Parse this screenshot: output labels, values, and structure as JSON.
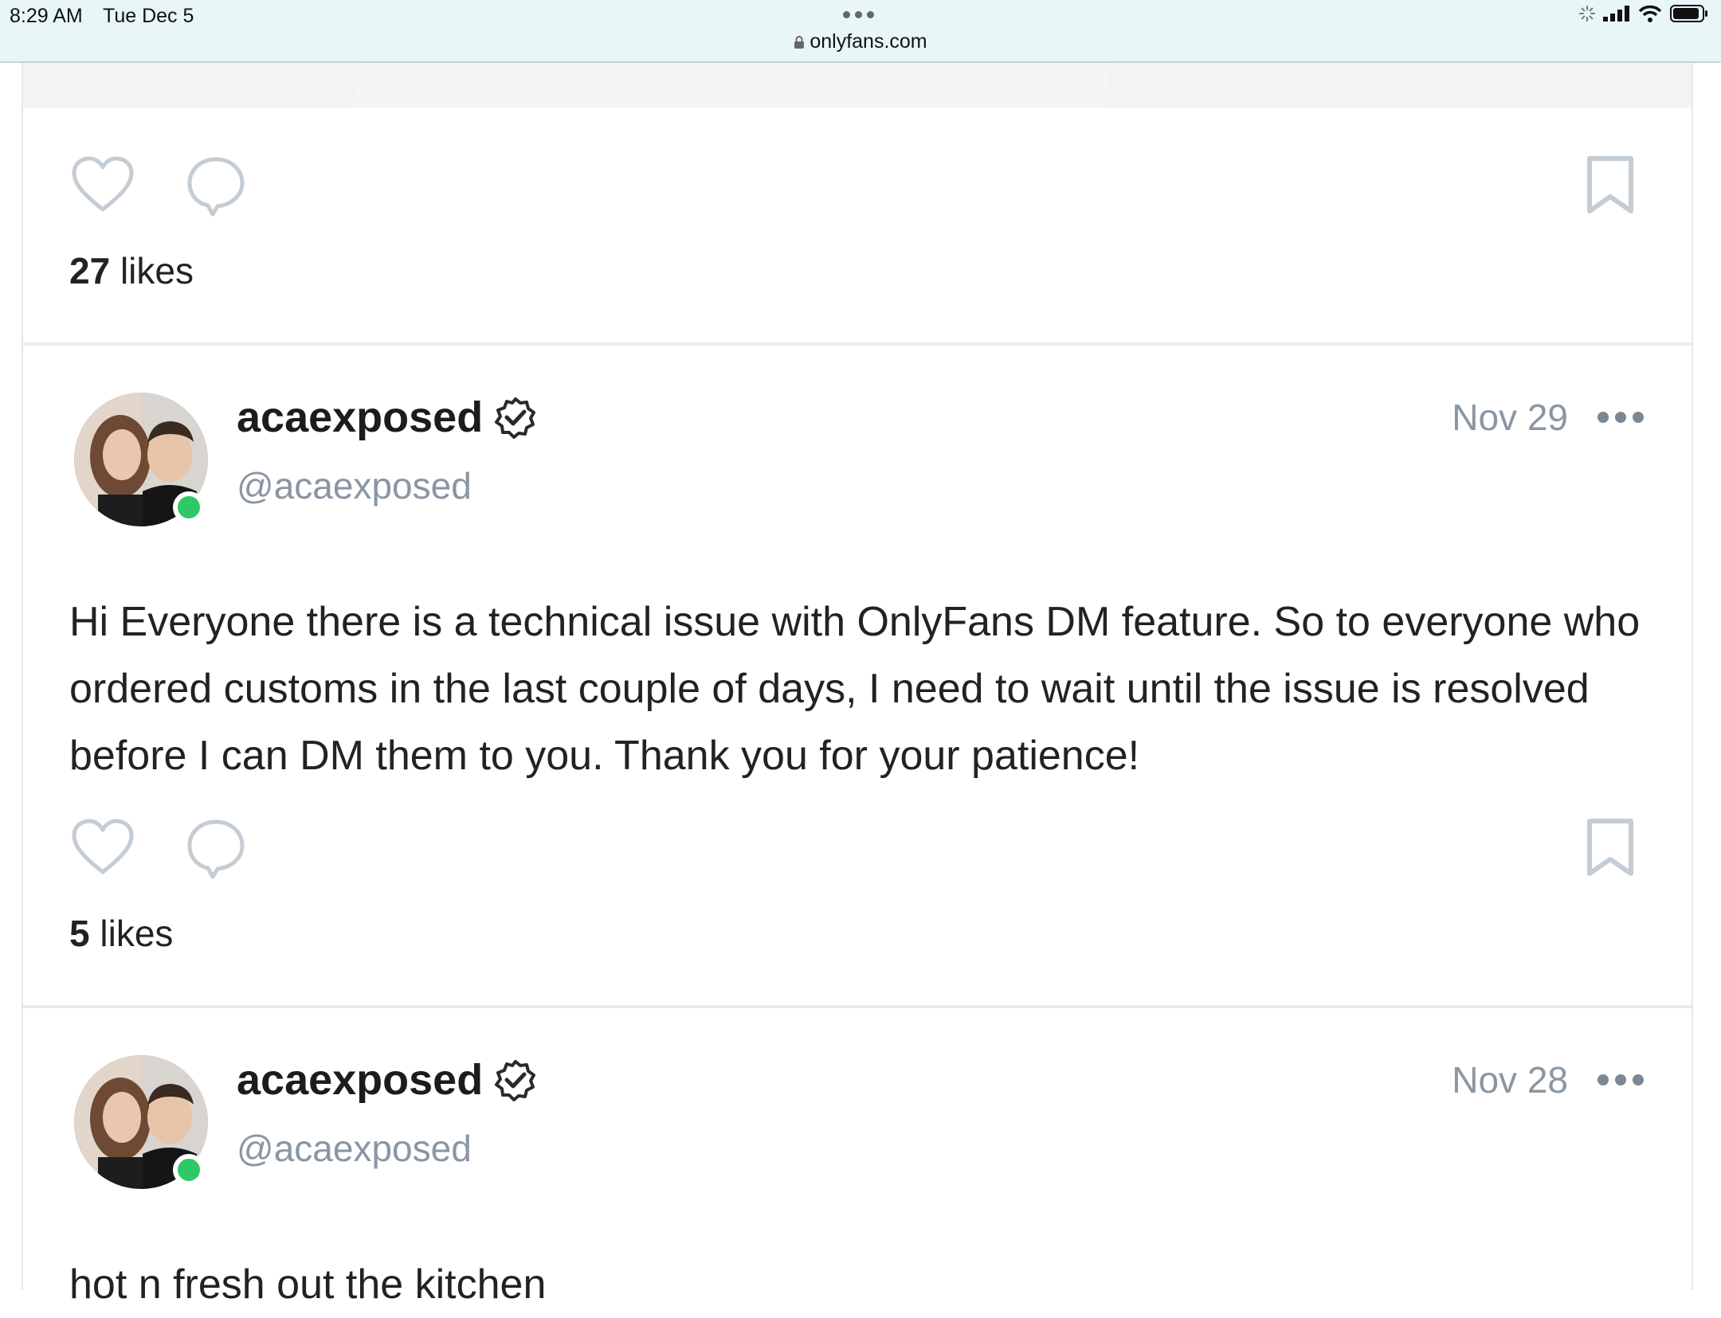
{
  "status_bar": {
    "time": "8:29 AM",
    "date": "Tue Dec 5",
    "url": "onlyfans.com"
  },
  "icons": {
    "like": "heart-outline-icon",
    "comment": "speech-bubble-icon",
    "bookmark": "bookmark-icon",
    "verified": "verified-badge-icon",
    "more": "more-horizontal-icon",
    "lock": "lock-icon"
  },
  "colors": {
    "online": "#2ec866",
    "muted_text": "#8a96a3",
    "icon_gray": "#c4ccd4"
  },
  "feed": {
    "previous_post": {
      "likes_count": "27",
      "likes_word": "likes"
    },
    "posts": [
      {
        "display_name": "acaexposed",
        "handle": "@acaexposed",
        "date": "Nov 29",
        "text": "Hi Everyone there is a technical issue with OnlyFans DM feature. So to everyone who ordered customs in the last couple of days, I need to wait until the issue is resolved before I can DM them to you. Thank you for your patience!",
        "likes_count": "5",
        "likes_word": "likes"
      },
      {
        "display_name": "acaexposed",
        "handle": "@acaexposed",
        "date": "Nov 28",
        "text": "hot n fresh out the kitchen"
      }
    ]
  }
}
